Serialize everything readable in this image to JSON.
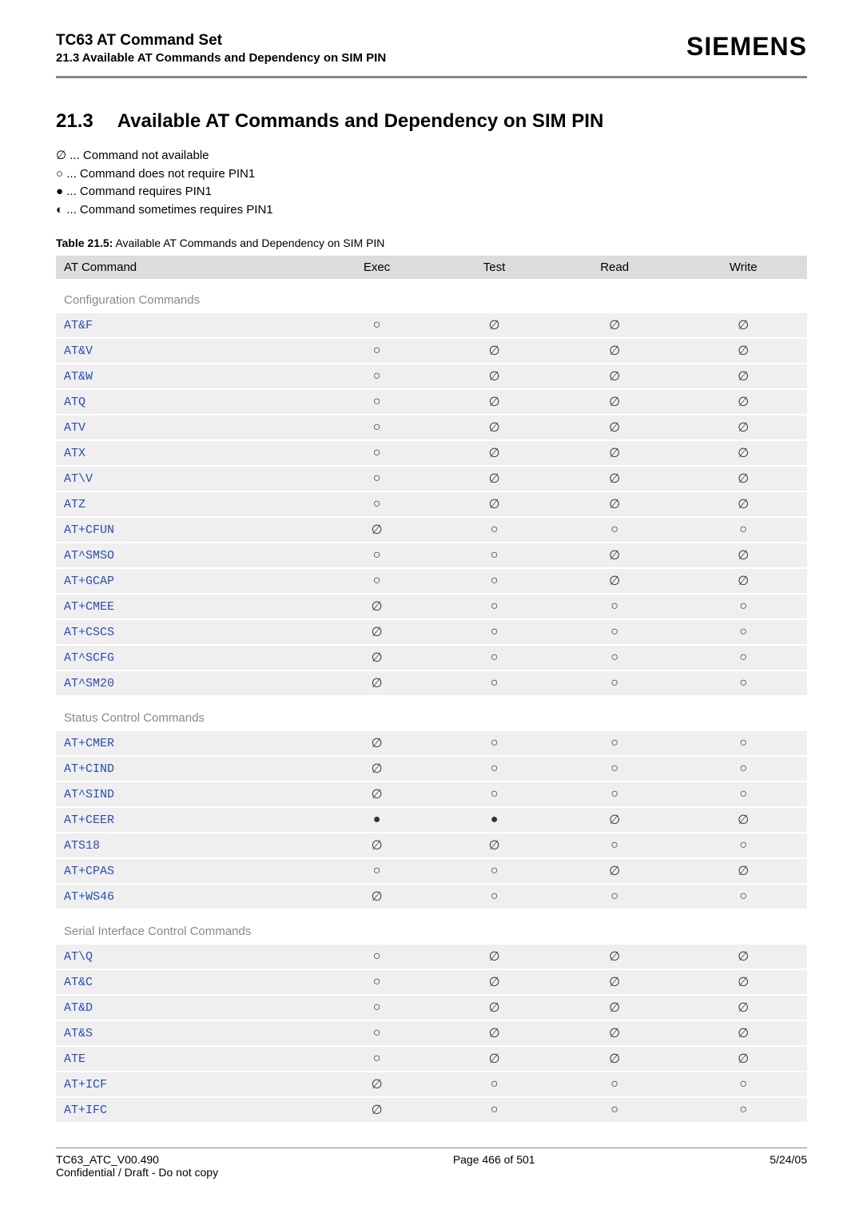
{
  "header": {
    "title": "TC63 AT Command Set",
    "subtitle": "21.3 Available AT Commands and Dependency on SIM PIN",
    "brand": "SIEMENS"
  },
  "section": {
    "num": "21.3",
    "title": "Available AT Commands and Dependency on SIM PIN"
  },
  "legend": {
    "l1": "∅ ... Command not available",
    "l2": "○ ... Command does not require PIN1",
    "l3": "● ... Command requires PIN1",
    "l4": "◐ ... Command sometimes requires PIN1"
  },
  "tablecap": {
    "label": "Table 21.5:",
    "text": " Available AT Commands and Dependency on SIM PIN"
  },
  "cols": {
    "c1": "AT Command",
    "c2": "Exec",
    "c3": "Test",
    "c4": "Read",
    "c5": "Write"
  },
  "groups": {
    "g1": "Configuration Commands",
    "g2": "Status Control Commands",
    "g3": "Serial Interface Control Commands"
  },
  "rows": {
    "r1": {
      "cmd": "AT&F",
      "exec": "○",
      "test": "∅",
      "read": "∅",
      "write": "∅"
    },
    "r2": {
      "cmd": "AT&V",
      "exec": "○",
      "test": "∅",
      "read": "∅",
      "write": "∅"
    },
    "r3": {
      "cmd": "AT&W",
      "exec": "○",
      "test": "∅",
      "read": "∅",
      "write": "∅"
    },
    "r4": {
      "cmd": "ATQ",
      "exec": "○",
      "test": "∅",
      "read": "∅",
      "write": "∅"
    },
    "r5": {
      "cmd": "ATV",
      "exec": "○",
      "test": "∅",
      "read": "∅",
      "write": "∅"
    },
    "r6": {
      "cmd": "ATX",
      "exec": "○",
      "test": "∅",
      "read": "∅",
      "write": "∅"
    },
    "r7": {
      "cmd": "AT\\V",
      "exec": "○",
      "test": "∅",
      "read": "∅",
      "write": "∅"
    },
    "r8": {
      "cmd": "ATZ",
      "exec": "○",
      "test": "∅",
      "read": "∅",
      "write": "∅"
    },
    "r9": {
      "cmd": "AT+CFUN",
      "exec": "∅",
      "test": "○",
      "read": "○",
      "write": "○"
    },
    "r10": {
      "cmd": "AT^SMSO",
      "exec": "○",
      "test": "○",
      "read": "∅",
      "write": "∅"
    },
    "r11": {
      "cmd": "AT+GCAP",
      "exec": "○",
      "test": "○",
      "read": "∅",
      "write": "∅"
    },
    "r12": {
      "cmd": "AT+CMEE",
      "exec": "∅",
      "test": "○",
      "read": "○",
      "write": "○"
    },
    "r13": {
      "cmd": "AT+CSCS",
      "exec": "∅",
      "test": "○",
      "read": "○",
      "write": "○"
    },
    "r14": {
      "cmd": "AT^SCFG",
      "exec": "∅",
      "test": "○",
      "read": "○",
      "write": "○"
    },
    "r15": {
      "cmd": "AT^SM20",
      "exec": "∅",
      "test": "○",
      "read": "○",
      "write": "○"
    },
    "r16": {
      "cmd": "AT+CMER",
      "exec": "∅",
      "test": "○",
      "read": "○",
      "write": "○"
    },
    "r17": {
      "cmd": "AT+CIND",
      "exec": "∅",
      "test": "○",
      "read": "○",
      "write": "○"
    },
    "r18": {
      "cmd": "AT^SIND",
      "exec": "∅",
      "test": "○",
      "read": "○",
      "write": "○"
    },
    "r19": {
      "cmd": "AT+CEER",
      "exec": "●",
      "test": "●",
      "read": "∅",
      "write": "∅"
    },
    "r20": {
      "cmd": "ATS18",
      "exec": "∅",
      "test": "∅",
      "read": "○",
      "write": "○"
    },
    "r21": {
      "cmd": "AT+CPAS",
      "exec": "○",
      "test": "○",
      "read": "∅",
      "write": "∅"
    },
    "r22": {
      "cmd": "AT+WS46",
      "exec": "∅",
      "test": "○",
      "read": "○",
      "write": "○"
    },
    "r23": {
      "cmd": "AT\\Q",
      "exec": "○",
      "test": "∅",
      "read": "∅",
      "write": "∅"
    },
    "r24": {
      "cmd": "AT&C",
      "exec": "○",
      "test": "∅",
      "read": "∅",
      "write": "∅"
    },
    "r25": {
      "cmd": "AT&D",
      "exec": "○",
      "test": "∅",
      "read": "∅",
      "write": "∅"
    },
    "r26": {
      "cmd": "AT&S",
      "exec": "○",
      "test": "∅",
      "read": "∅",
      "write": "∅"
    },
    "r27": {
      "cmd": "ATE",
      "exec": "○",
      "test": "∅",
      "read": "∅",
      "write": "∅"
    },
    "r28": {
      "cmd": "AT+ICF",
      "exec": "∅",
      "test": "○",
      "read": "○",
      "write": "○"
    },
    "r29": {
      "cmd": "AT+IFC",
      "exec": "∅",
      "test": "○",
      "read": "○",
      "write": "○"
    }
  },
  "footer": {
    "left1": "TC63_ATC_V00.490",
    "left2": "Confidential / Draft - Do not copy",
    "center": "Page 466 of 501",
    "right": "5/24/05"
  }
}
